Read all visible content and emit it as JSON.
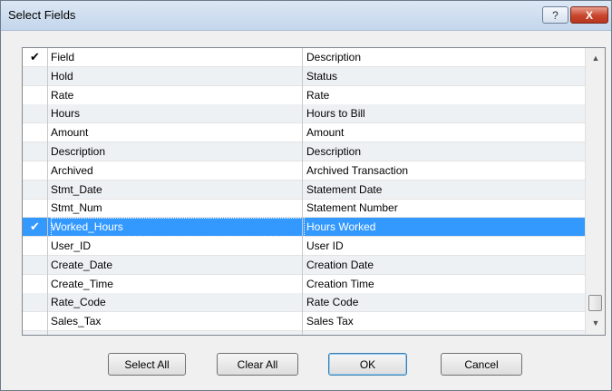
{
  "window": {
    "title": "Select Fields",
    "help_glyph": "?",
    "close_glyph": "X"
  },
  "list": {
    "check_glyph": "✔",
    "rows": [
      {
        "checked": true,
        "field": "Field",
        "description": "Description"
      },
      {
        "checked": false,
        "field": "Hold",
        "description": "Status"
      },
      {
        "checked": false,
        "field": "Rate",
        "description": "Rate"
      },
      {
        "checked": false,
        "field": "Hours",
        "description": "Hours to Bill"
      },
      {
        "checked": false,
        "field": "Amount",
        "description": "Amount"
      },
      {
        "checked": false,
        "field": "Description",
        "description": "Description"
      },
      {
        "checked": false,
        "field": "Archived",
        "description": "Archived Transaction"
      },
      {
        "checked": false,
        "field": "Stmt_Date",
        "description": "Statement Date"
      },
      {
        "checked": false,
        "field": "Stmt_Num",
        "description": "Statement Number"
      },
      {
        "checked": true,
        "selected": true,
        "field": "Worked_Hours",
        "description": "Hours Worked"
      },
      {
        "checked": false,
        "field": "User_ID",
        "description": "User ID"
      },
      {
        "checked": false,
        "field": "Create_Date",
        "description": "Creation Date"
      },
      {
        "checked": false,
        "field": "Create_Time",
        "description": "Creation Time"
      },
      {
        "checked": false,
        "field": "Rate_Code",
        "description": "Rate Code"
      },
      {
        "checked": false,
        "field": "Sales_Tax",
        "description": "Sales Tax"
      },
      {
        "checked": false,
        "field": "",
        "description": ""
      }
    ],
    "scroll": {
      "up": "▲",
      "down": "▼"
    }
  },
  "buttons": {
    "select_all": "Select All",
    "clear_all": "Clear All",
    "ok": "OK",
    "cancel": "Cancel"
  }
}
